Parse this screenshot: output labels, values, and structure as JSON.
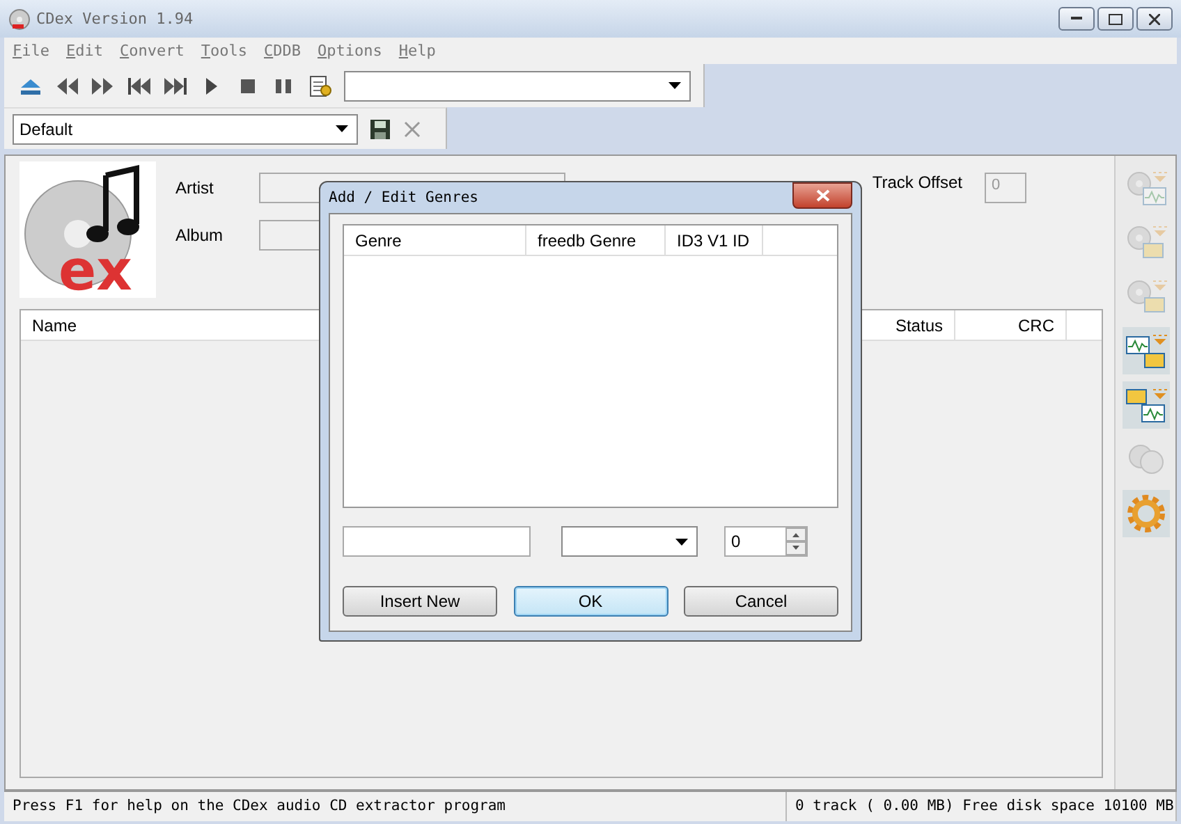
{
  "window": {
    "title": "CDex Version 1.94"
  },
  "logo": {
    "text": "ex"
  },
  "menu": [
    "File",
    "Edit",
    "Convert",
    "Tools",
    "CDDB",
    "Options",
    "Help"
  ],
  "profile": {
    "value": "Default"
  },
  "fields": [
    {
      "label": "Artist"
    },
    {
      "label": "Album"
    }
  ],
  "track_offset": {
    "label": "Track Offset",
    "value": "0"
  },
  "track_list": {
    "columns": [
      "Name",
      "Status",
      "CRC"
    ]
  },
  "side_tools": [
    {
      "kind": "ripwave",
      "disabled": true
    },
    {
      "kind": "ripfile",
      "disabled": true
    },
    {
      "kind": "ripmix",
      "disabled": true
    },
    {
      "kind": "wavefile",
      "disabled": false
    },
    {
      "kind": "filewave",
      "disabled": false
    },
    {
      "kind": "player",
      "disabled": true
    },
    {
      "kind": "config",
      "disabled": false
    }
  ],
  "dialog": {
    "title": "Add / Edit Genres",
    "columns": [
      "Genre",
      "freedb Genre",
      "ID3 V1 ID"
    ],
    "id_value": "0",
    "buttons": [
      {
        "label": "Insert New",
        "default": false
      },
      {
        "label": "OK",
        "default": true
      },
      {
        "label": "Cancel",
        "default": false
      }
    ]
  },
  "status_bar": [
    "Press F1 for help on the CDex audio CD extractor program",
    "0 track ( 0.00 MB) Free disk space 10100 MB"
  ]
}
